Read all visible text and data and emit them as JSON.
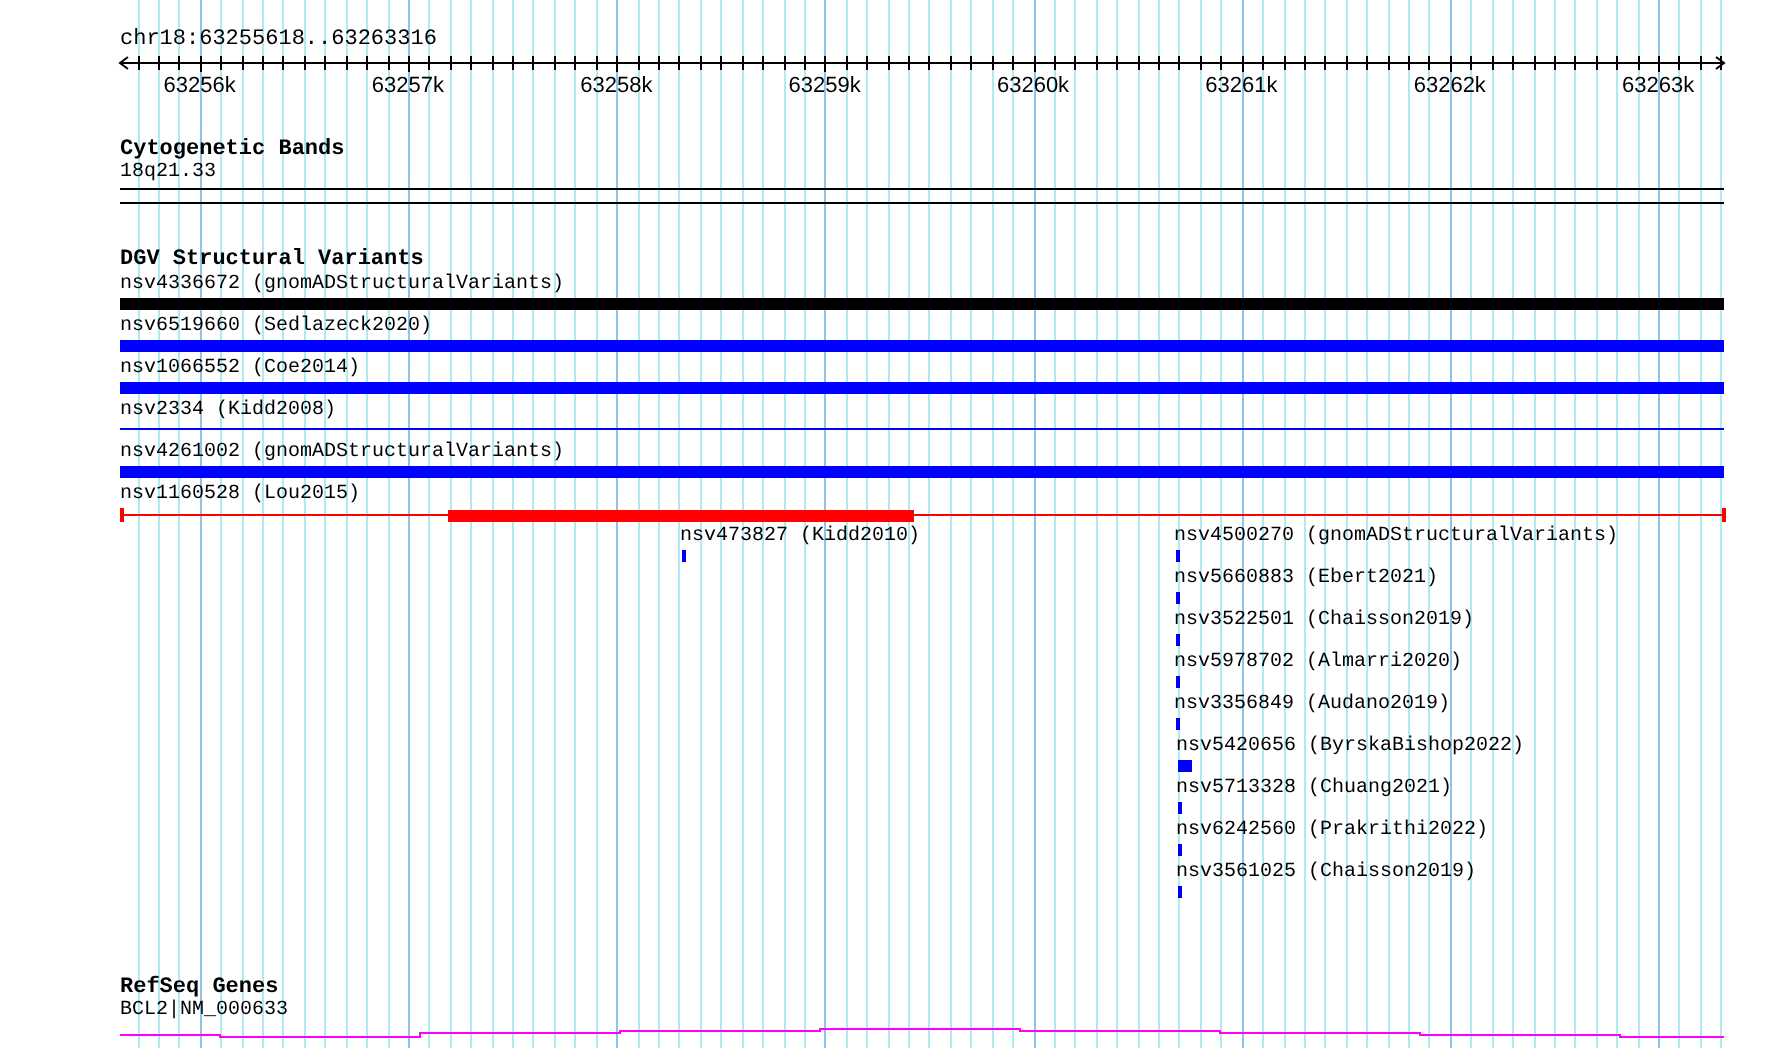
{
  "ruler": {
    "location": "chr18:63255618..63263316",
    "ticks": [
      "63256k",
      "63257k",
      "63258k",
      "63259k",
      "63260k",
      "63261k",
      "63262k",
      "63263k"
    ]
  },
  "tracks": [
    {
      "kind": "bands",
      "title": "Cytogenetic Bands",
      "features": [
        {
          "label": "18q21.33"
        }
      ]
    },
    {
      "kind": "variants",
      "title": "DGV Structural Variants",
      "features": [
        {
          "label": "nsv4336672 (gnomADStructuralVariants)",
          "color": "#000000"
        },
        {
          "label": "nsv6519660 (Sedlazeck2020)",
          "color": "#0000ff"
        },
        {
          "label": "nsv1066552 (Coe2014)",
          "color": "#0000ff"
        },
        {
          "label": "nsv2334 (Kidd2008)",
          "color": "#0000ff"
        },
        {
          "label": "nsv4261002 (gnomADStructuralVariants)",
          "color": "#0000ff"
        },
        {
          "label": "nsv1160528 (Lou2015)",
          "color": "#ff0000"
        },
        {
          "label": "nsv473827 (Kidd2010)",
          "color": "#0000ff"
        },
        {
          "label": "nsv4500270 (gnomADStructuralVariants)",
          "color": "#0000ff"
        },
        {
          "label": "nsv5660883 (Ebert2021)",
          "color": "#0000ff"
        },
        {
          "label": "nsv3522501 (Chaisson2019)",
          "color": "#0000ff"
        },
        {
          "label": "nsv5978702 (Almarri2020)",
          "color": "#0000ff"
        },
        {
          "label": "nsv3356849 (Audano2019)",
          "color": "#0000ff"
        },
        {
          "label": "nsv5420656 (ByrskaBishop2022)",
          "color": "#0000ff"
        },
        {
          "label": "nsv5713328 (Chuang2021)",
          "color": "#0000ff"
        },
        {
          "label": "nsv6242560 (Prakrithi2022)",
          "color": "#0000ff"
        },
        {
          "label": "nsv3561025 (Chaisson2019)",
          "color": "#0000ff"
        }
      ]
    },
    {
      "kind": "genes",
      "title": "RefSeq Genes",
      "features": [
        {
          "label": "BCL2|NM_000633",
          "color": "#ff00ff"
        }
      ]
    }
  ]
}
